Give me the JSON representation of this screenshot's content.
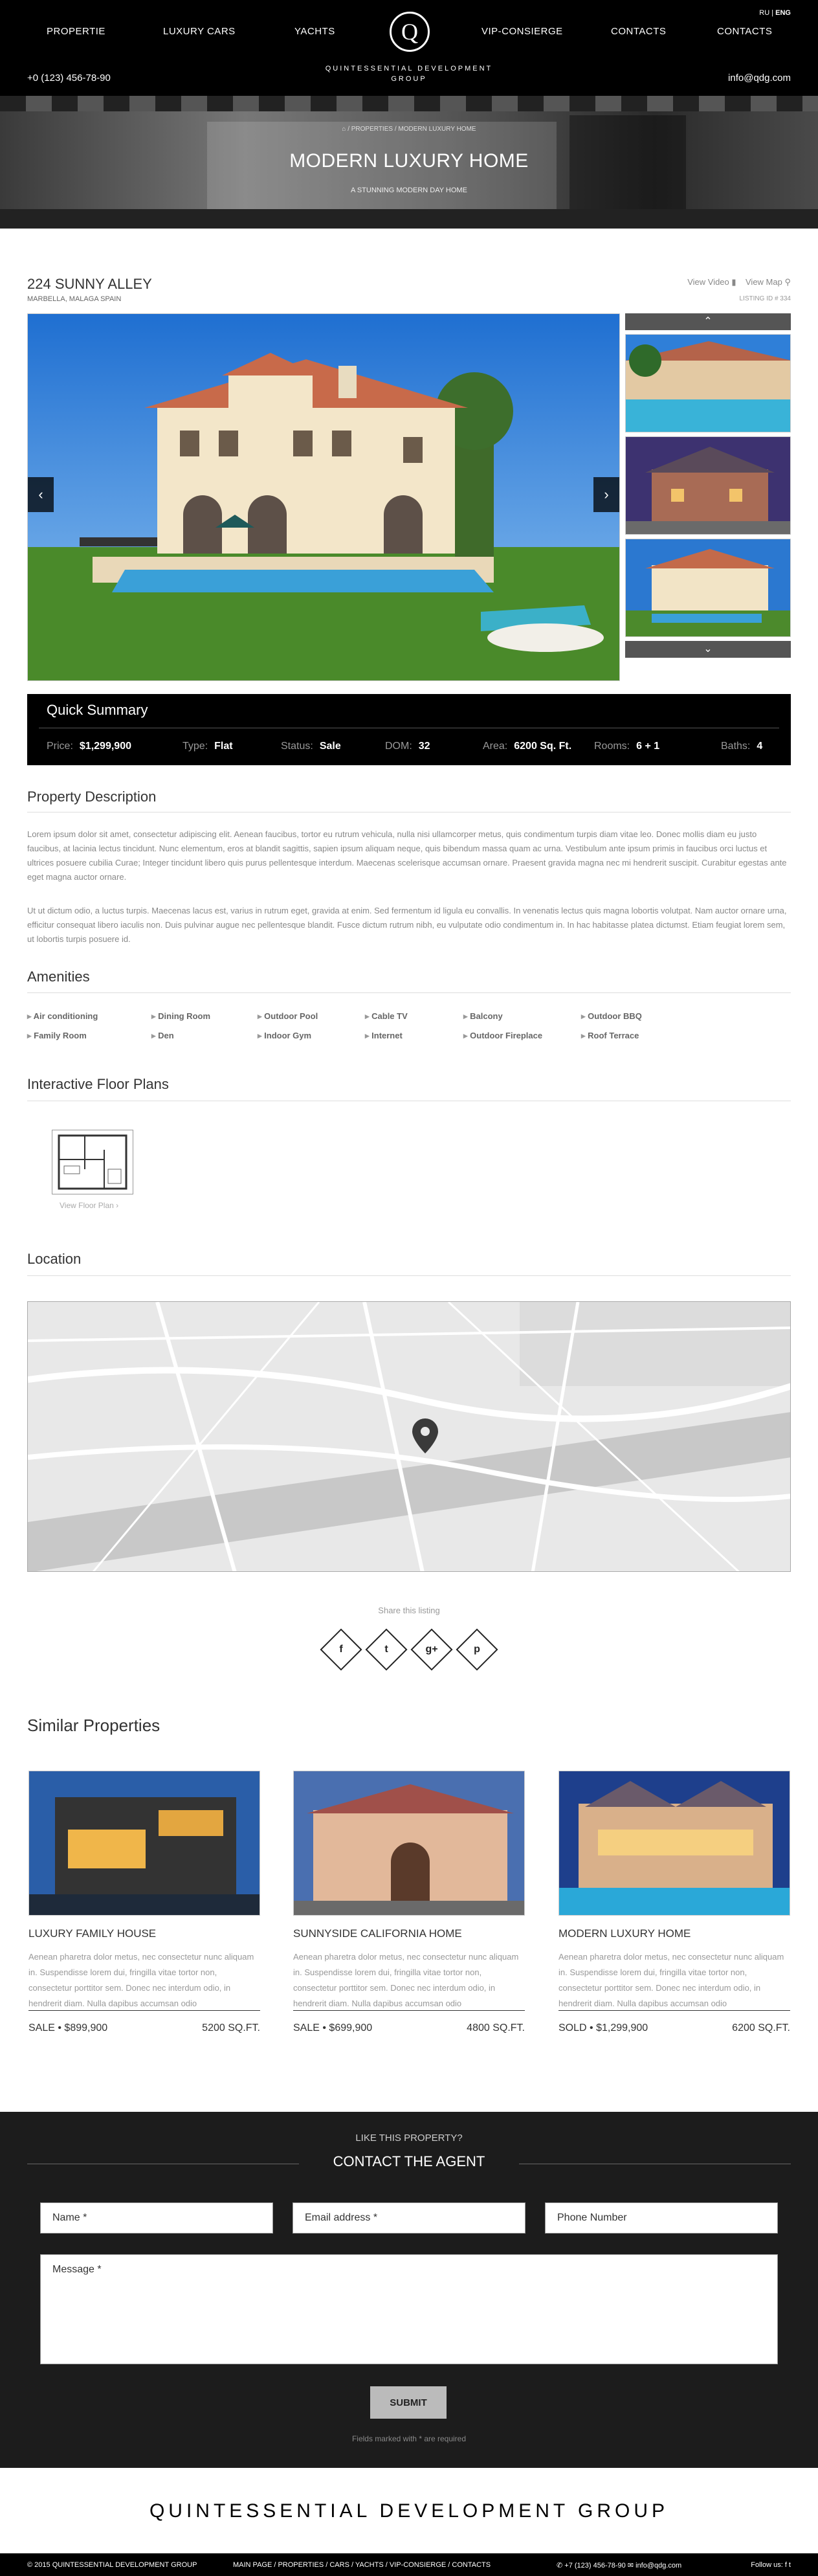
{
  "header": {
    "lang_ru": "RU",
    "lang_sep": " | ",
    "lang_en": "ENG",
    "nav": [
      "PROPERTIE",
      "LUXURY CARS",
      "YACHTS",
      "VIP-CONSIERGE",
      "CONTACTS",
      "CONTACTS"
    ],
    "logo_letter": "Q",
    "brand_line1": "QUINTESSENTIAL DEVELOPMENT",
    "brand_line2": "GROUP",
    "phone": "+0 (123) 456-78-90",
    "email": "info@qdg.com"
  },
  "hero": {
    "breadcrumb": "⌂ / PROPERTIES / MODERN LUXURY HOME",
    "title": "MODERN LUXURY HOME",
    "subtitle": "A STUNNING MODERN DAY HOME"
  },
  "listing": {
    "address": "224 SUNNY ALLEY",
    "city": "MARBELLA, MALAGA SPAIN",
    "view_video": "View Video",
    "view_map": "View Map",
    "listing_id": "LISTING ID # 334"
  },
  "quick_summary": {
    "title": "Quick Summary",
    "fields": [
      {
        "label": "Price:",
        "value": "$1,299,900"
      },
      {
        "label": "Type:",
        "value": "Flat"
      },
      {
        "label": "Status:",
        "value": "Sale"
      },
      {
        "label": "DOM:",
        "value": "32"
      },
      {
        "label": "Area:",
        "value": "6200 Sq. Ft."
      },
      {
        "label": "Rooms:",
        "value": "6 + 1"
      },
      {
        "label": "Baths:",
        "value": "4"
      }
    ]
  },
  "description": {
    "title": "Property Description",
    "p1": "Lorem ipsum dolor sit amet, consectetur adipiscing elit. Aenean faucibus, tortor eu rutrum vehicula, nulla nisi ullamcorper metus, quis condimentum turpis diam vitae leo. Donec mollis diam eu justo faucibus, at lacinia lectus tincidunt. Nunc elementum, eros at blandit sagittis, sapien ipsum aliquam neque, quis bibendum massa quam ac urna. Vestibulum ante ipsum primis in faucibus orci luctus et ultrices posuere cubilia Curae; Integer tincidunt libero quis purus pellentesque interdum. Maecenas scelerisque accumsan ornare. Praesent gravida magna nec mi hendrerit suscipit. Curabitur egestas ante eget magna auctor ornare.",
    "p2": "Ut ut dictum odio, a luctus turpis. Maecenas lacus est, varius in rutrum eget, gravida at enim. Sed fermentum id ligula eu convallis. In venenatis lectus quis magna lobortis volutpat. Nam auctor ornare urna, efficitur consequat libero iaculis non. Duis pulvinar augue nec pellentesque blandit. Fusce dictum rutrum nibh, eu vulputate odio condimentum in. In hac habitasse platea dictumst. Etiam feugiat lorem sem, ut lobortis turpis posuere id."
  },
  "amenities": {
    "title": "Amenities",
    "items": [
      "Air conditioning",
      "Dining Room",
      "Outdoor Pool",
      "Cable TV",
      "Balcony",
      "Outdoor BBQ",
      "Family Room",
      "Den",
      "Indoor Gym",
      "Internet",
      "Outdoor Fireplace",
      "Roof Terrace"
    ]
  },
  "floorplans": {
    "title": "Interactive Floor Plans",
    "link": "View Floor Plan ›"
  },
  "location": {
    "title": "Location"
  },
  "share": {
    "label": "Share this listing",
    "icons": [
      "f",
      "t",
      "g+",
      "p"
    ]
  },
  "similar": {
    "title": "Similar Properties",
    "desc": "Aenean pharetra dolor metus, nec consectetur nunc aliquam in. Suspendisse lorem dui, fringilla vitae tortor non, consectetur porttitor sem. Donec nec interdum odio, in hendrerit diam. Nulla dapibus accumsan odio",
    "cards": [
      {
        "title": "LUXURY FAMILY HOUSE",
        "status": "SALE",
        "price": "$899,900",
        "size": "5200 SQ.FT."
      },
      {
        "title": "SUNNYSIDE CALIFORNIA HOME",
        "status": "SALE",
        "price": "$699,900",
        "size": "4800 SQ.FT."
      },
      {
        "title": "MODERN LUXURY HOME",
        "status": "SOLD",
        "price": "$1,299,900",
        "size": "6200 SQ.FT."
      }
    ]
  },
  "contact": {
    "question": "LIKE THIS PROPERTY?",
    "title": "CONTACT THE AGENT",
    "name_ph": "Name *",
    "email_ph": "Email address *",
    "phone_ph": "Phone Number",
    "message_ph": "Message *",
    "submit": "SUBMIT",
    "required": "Fields marked with * are required"
  },
  "footer": {
    "brand": "QUINTESSENTIAL DEVELOPMENT GROUP",
    "copyright": "© 2015 QUINTESSENTIAL DEVELOPMENT GROUP",
    "menu": "MAIN PAGE  /  PROPERTIES  /  CARS  /  YACHTS  /  VIP-CONSIERGE  /  CONTACTS",
    "contact": "✆ +7 (123) 456-78-90  ✉ info@qdg.com",
    "follow": "Follow us:  f   t"
  }
}
